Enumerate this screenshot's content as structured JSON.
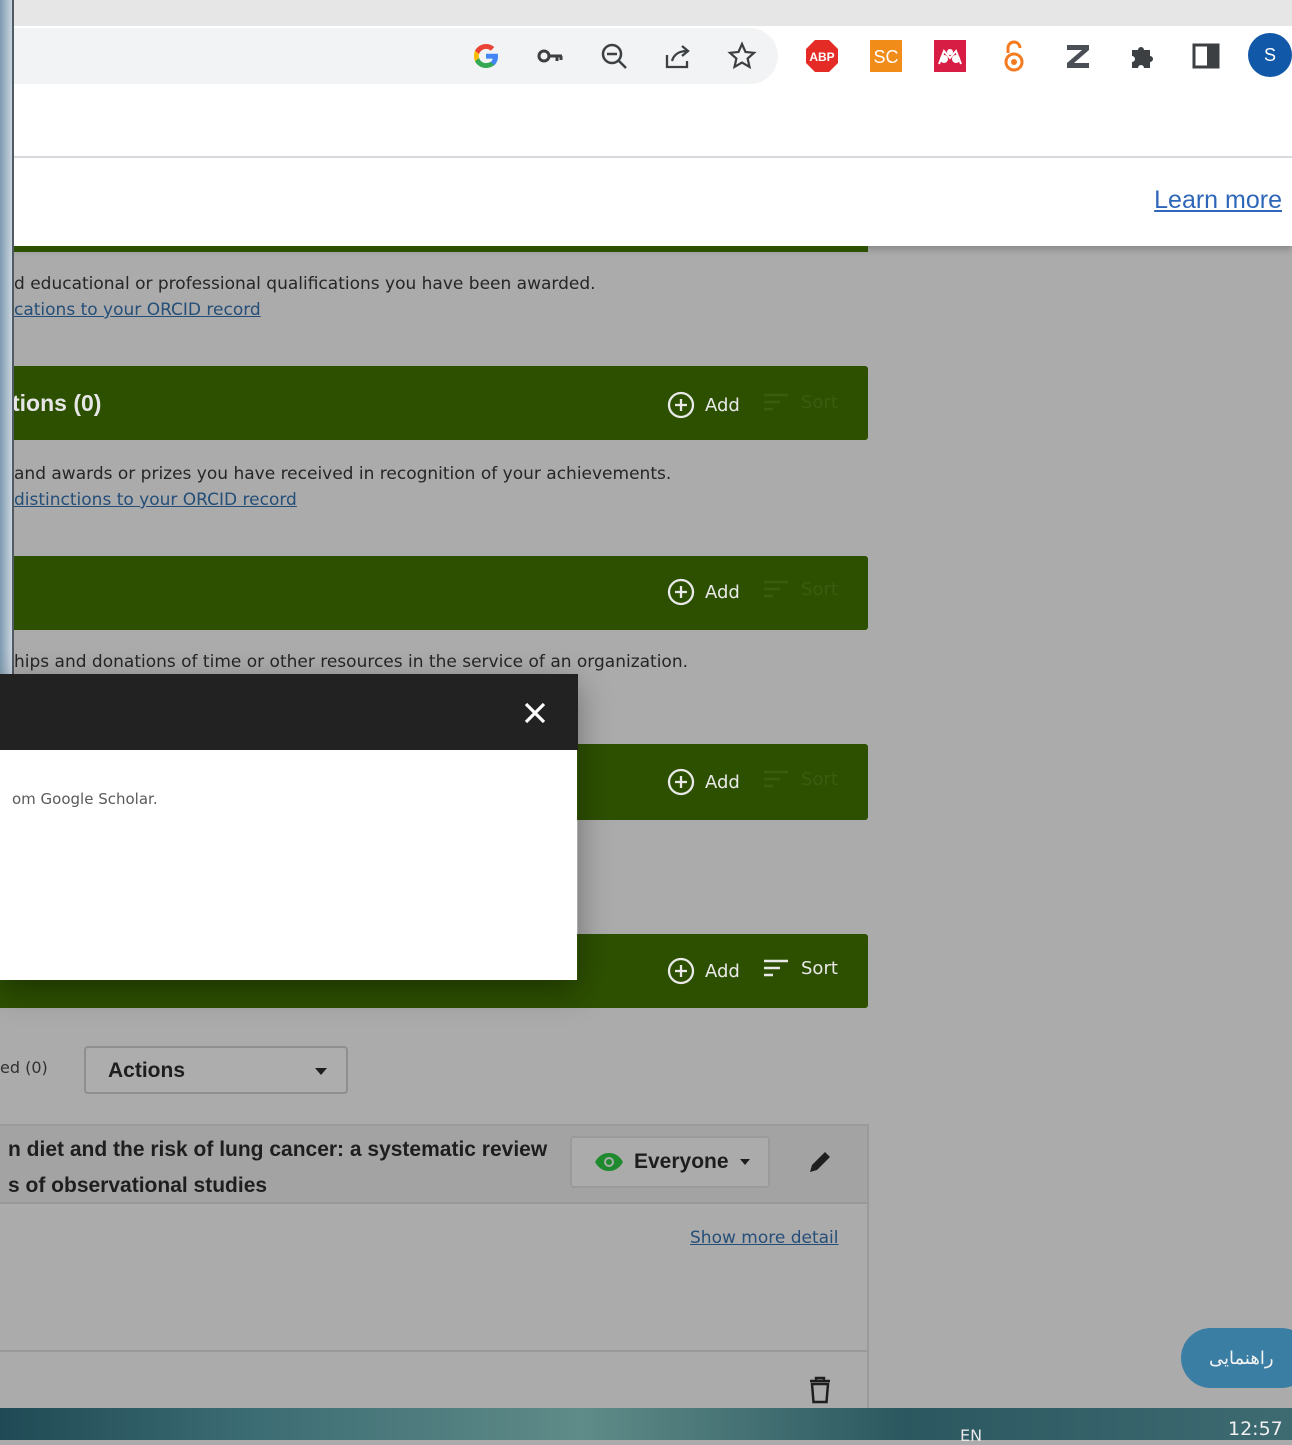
{
  "browser": {
    "extensions": [
      "google-icon",
      "password-key-icon",
      "zoom-out-icon",
      "share-icon",
      "bookmark-star-icon",
      "adblock-plus-icon",
      "scholarcy-icon",
      "mendeley-icon",
      "open-access-icon",
      "zotero-icon",
      "extensions-puzzle-icon",
      "side-panel-icon",
      "profile-avatar-icon"
    ],
    "abp_label": "ABP",
    "sc_label": "SC",
    "profile_initial": "S"
  },
  "cookie_banner": {
    "learn_more": "Learn more"
  },
  "sections": {
    "qualifications": {
      "description": "d educational or professional qualifications you have been awarded.",
      "link": "cations to your ORCID record"
    },
    "distinctions": {
      "title": "tions (0)",
      "add_label": "Add",
      "sort_label": "Sort",
      "description": "and awards or prizes you have received in recognition of your achievements.",
      "link": "distinctions to your ORCID record"
    },
    "memberships": {
      "add_label": "Add",
      "sort_label": "Sort",
      "description": "hips and donations of time or other resources in the service of an organization."
    },
    "services": {
      "add_label": "Add",
      "sort_label": "Sort"
    },
    "works": {
      "add_label": "Add",
      "sort_label": "Sort",
      "selected": "ed (0)",
      "actions_label": "Actions",
      "item": {
        "title_line1": "n diet and the risk of lung cancer: a systematic review",
        "title_line2": "s of observational studies",
        "visibility": "Everyone",
        "show_more": "Show more detail"
      }
    }
  },
  "modal": {
    "body_text": "om Google Scholar."
  },
  "help_button": {
    "label": "راهنمایی"
  },
  "taskbar": {
    "lang": "EN",
    "time": "12:57"
  },
  "colors": {
    "section_bar": "#2d5000",
    "link": "#2f67b8",
    "modal_header": "#222222"
  }
}
